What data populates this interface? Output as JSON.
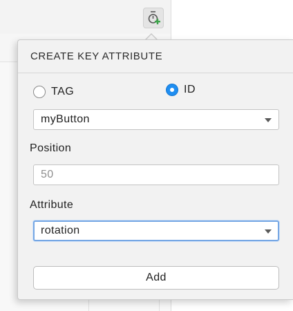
{
  "toolbar": {
    "keyframe_icon": "add-keyframe-icon"
  },
  "popup": {
    "title": "CREATE KEY ATTRIBUTE",
    "options": [
      {
        "label": "TAG",
        "selected": false
      },
      {
        "label": "ID",
        "selected": true
      }
    ],
    "target_select": {
      "value": "myButton"
    },
    "position_label": "Position",
    "position_input": {
      "placeholder": "50"
    },
    "attribute_label": "Attribute",
    "attribute_select": {
      "value": "rotation"
    },
    "add_label": "Add"
  },
  "colors": {
    "accent": "#1f8ef1",
    "focus": "#76a7e4",
    "popup_bg": "#f2f2f2"
  }
}
